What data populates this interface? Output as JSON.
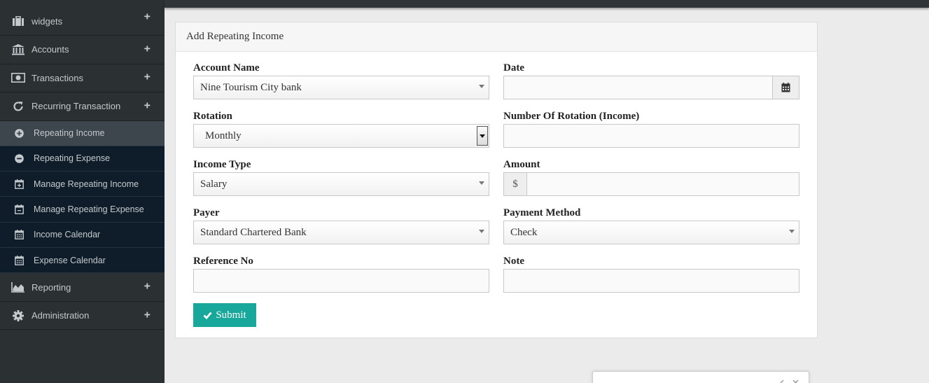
{
  "sidebar": {
    "items": [
      {
        "label": "widgets",
        "icon": "briefcase-icon"
      },
      {
        "label": "Accounts",
        "icon": "bank-icon"
      },
      {
        "label": "Transactions",
        "icon": "money-icon"
      },
      {
        "label": "Recurring Transaction",
        "icon": "refresh-icon"
      }
    ],
    "sub_items": [
      {
        "label": "Repeating Income",
        "icon": "plus-circle-icon",
        "active": true
      },
      {
        "label": "Repeating Expense",
        "icon": "minus-circle-icon"
      },
      {
        "label": "Manage Repeating Income",
        "icon": "calendar-plus-icon"
      },
      {
        "label": "Manage Repeating Expense",
        "icon": "calendar-minus-icon"
      },
      {
        "label": "Income Calendar",
        "icon": "calendar-icon"
      },
      {
        "label": "Expense Calendar",
        "icon": "calendar-icon"
      }
    ],
    "bottom_items": [
      {
        "label": "Reporting",
        "icon": "area-chart-icon"
      },
      {
        "label": "Administration",
        "icon": "gear-icon"
      }
    ],
    "expand_symbol": "+"
  },
  "form": {
    "title": "Add Repeating Income",
    "account_name": {
      "label": "Account Name",
      "value": "Nine Tourism City bank"
    },
    "date": {
      "label": "Date",
      "value": ""
    },
    "rotation": {
      "label": "Rotation",
      "value": "Monthly"
    },
    "num_rotation": {
      "label": "Number Of Rotation (Income)",
      "value": ""
    },
    "income_type": {
      "label": "Income Type",
      "value": "Salary"
    },
    "amount": {
      "label": "Amount",
      "prefix": "$",
      "value": ""
    },
    "payer": {
      "label": "Payer",
      "value": "Standard Chartered Bank"
    },
    "payment_method": {
      "label": "Payment Method",
      "value": "Check"
    },
    "reference_no": {
      "label": "Reference No",
      "value": ""
    },
    "note": {
      "label": "Note",
      "value": ""
    },
    "submit_label": "Submit"
  },
  "colors": {
    "sidebar_bg": "#2b3033",
    "submenu_bg": "#0f1d2a",
    "accent": "#17a89b"
  }
}
